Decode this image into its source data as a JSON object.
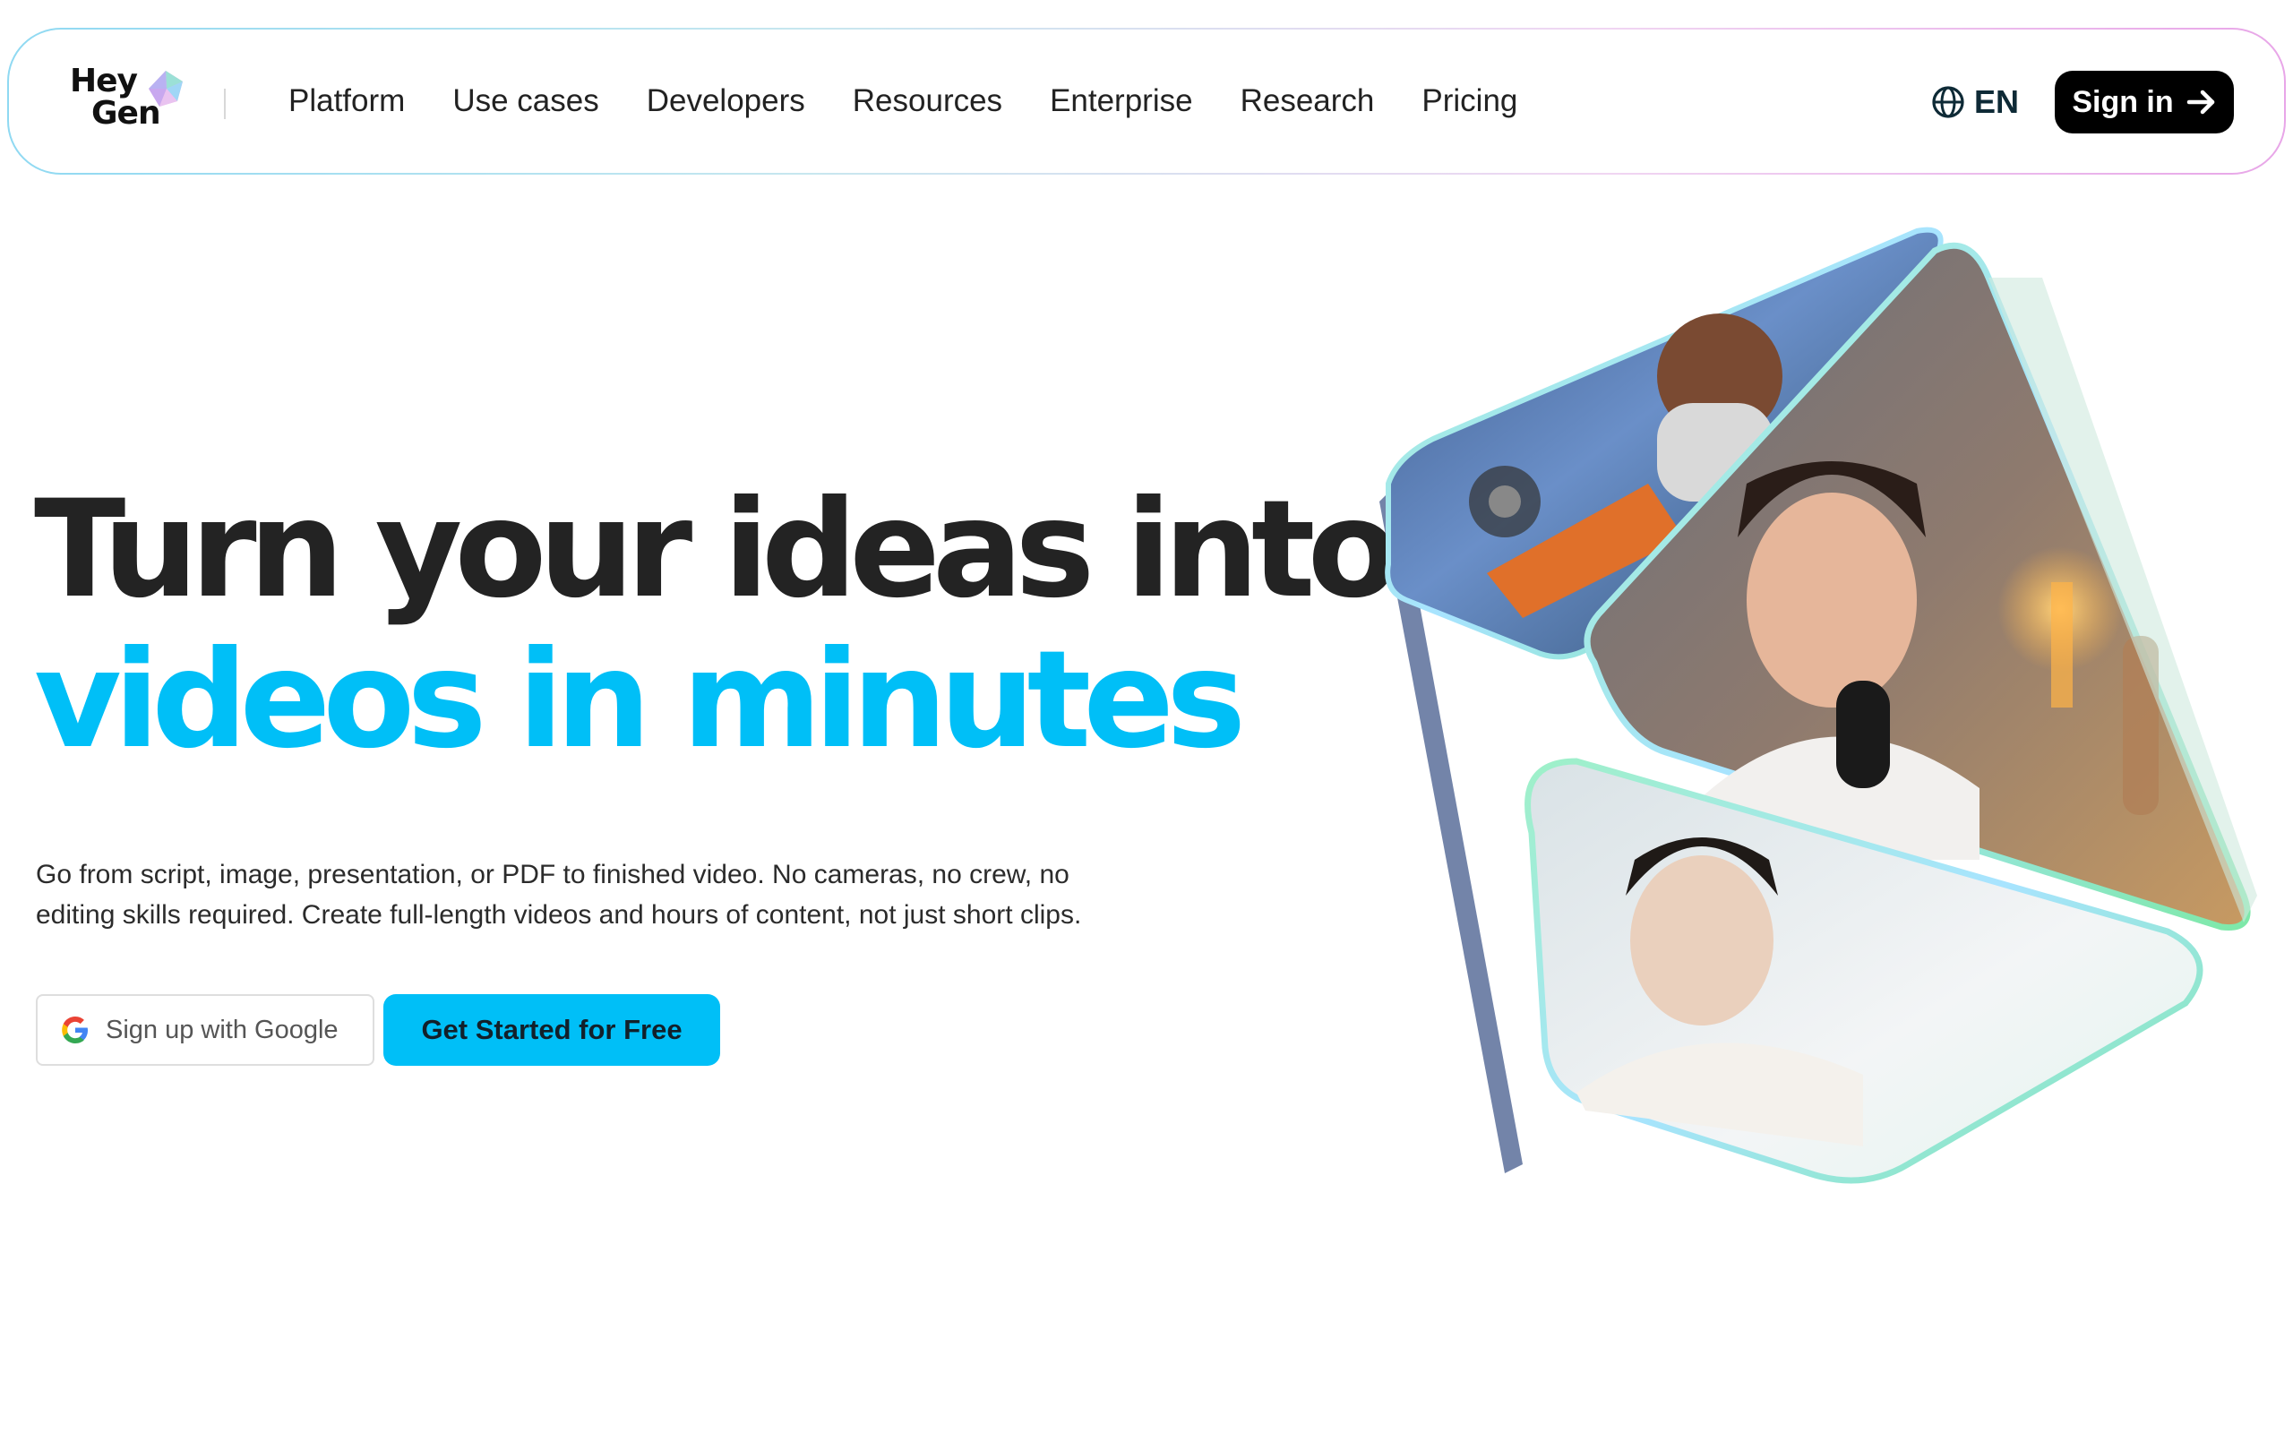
{
  "brand": {
    "logo_line1": "Hey",
    "logo_line2": "Gen"
  },
  "nav": {
    "links": [
      "Platform",
      "Use cases",
      "Developers",
      "Resources",
      "Enterprise",
      "Research",
      "Pricing"
    ],
    "language": "EN",
    "signin_label": "Sign in"
  },
  "hero": {
    "headline_line1": "Turn your ideas into",
    "headline_line2": "videos in minutes",
    "subtitle": "Go from script, image, presentation, or PDF to finished video. No cameras, no crew, no editing skills required. Create full-length videos and hours of content, not just short clips.",
    "google_button_label": "Sign up with Google",
    "cta_label": "Get Started for Free"
  },
  "colors": {
    "accent": "#00bff7",
    "headline_dark": "#232323",
    "signin_bg": "#000000"
  },
  "icons": {
    "language": "globe-icon",
    "signin": "arrow-right-icon",
    "google": "google-g-icon",
    "logo": "gem-icon"
  }
}
